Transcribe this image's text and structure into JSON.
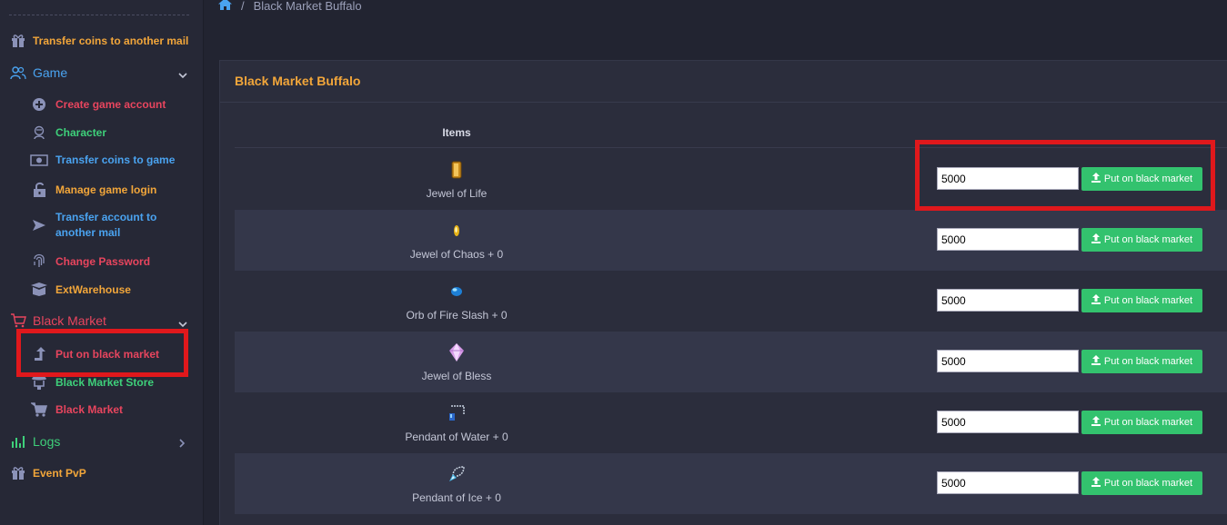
{
  "breadcrumb": {
    "current": "Black Market Buffalo"
  },
  "sidebar": {
    "top_item": {
      "label": "Transfer coins to another mail",
      "color": "#f2a63a",
      "icon": "gift-icon"
    },
    "game_group": {
      "label": "Game",
      "color": "#4aa3f0",
      "icon": "users-icon",
      "items": [
        {
          "label": "Create game account",
          "color": "#e8455e",
          "icon": "plus-circle-icon"
        },
        {
          "label": "Character",
          "color": "#3ed07a",
          "icon": "character-icon"
        },
        {
          "label": "Transfer coins to game",
          "color": "#4aa3f0",
          "icon": "money-icon"
        },
        {
          "label": "Manage game login",
          "color": "#f2a63a",
          "icon": "unlock-icon"
        },
        {
          "label": "Transfer account to another mail",
          "color": "#4aa3f0",
          "icon": "send-icon"
        },
        {
          "label": "Change Password",
          "color": "#e8455e",
          "icon": "fingerprint-icon"
        },
        {
          "label": "ExtWarehouse",
          "color": "#f2a63a",
          "icon": "box-icon"
        }
      ]
    },
    "black_market_group": {
      "label": "Black Market",
      "color": "#e8455e",
      "icon": "cart-icon",
      "items": [
        {
          "label": "Put on black market",
          "color": "#e8455e",
          "icon": "upload-arrow-icon"
        },
        {
          "label": "Black Market Store",
          "color": "#3ed07a",
          "icon": "store-icon"
        },
        {
          "label": "Black Market",
          "color": "#e8455e",
          "icon": "cart-icon"
        }
      ]
    },
    "logs_group": {
      "label": "Logs",
      "color": "#3ed07a",
      "icon": "bar-chart-icon"
    },
    "event_item": {
      "label": "Event PvP",
      "color": "#f2a63a",
      "icon": "gift-icon"
    }
  },
  "card": {
    "title": "Black Market Buffalo",
    "column_items": "Items",
    "rows": [
      {
        "name": "Jewel of Life",
        "price": "5000",
        "button": "Put on black market",
        "icon": "jewel-of-life-icon"
      },
      {
        "name": "Jewel of Chaos + 0",
        "price": "5000",
        "button": "Put on black market",
        "icon": "jewel-of-chaos-icon"
      },
      {
        "name": "Orb of Fire Slash + 0",
        "price": "5000",
        "button": "Put on black market",
        "icon": "orb-icon"
      },
      {
        "name": "Jewel of Bless",
        "price": "5000",
        "button": "Put on black market",
        "icon": "jewel-of-bless-icon"
      },
      {
        "name": "Pendant of Water + 0",
        "price": "5000",
        "button": "Put on black market",
        "icon": "pendant-water-icon"
      },
      {
        "name": "Pendant of Ice + 0",
        "price": "5000",
        "button": "Put on black market",
        "icon": "pendant-ice-icon"
      }
    ]
  },
  "colors": {
    "accent_orange": "#f2a63a",
    "button_green": "#33c26e",
    "highlight_red": "#e0181c"
  }
}
